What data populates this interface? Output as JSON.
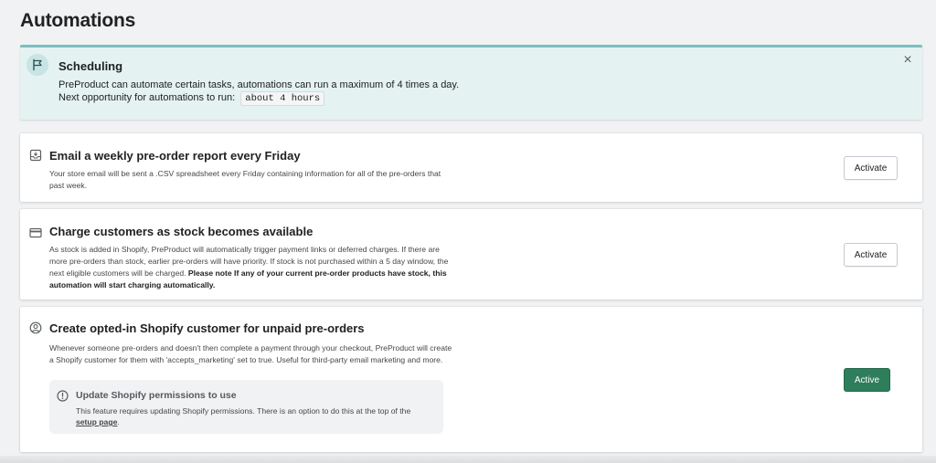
{
  "page": {
    "title": "Automations"
  },
  "banner": {
    "title": "Scheduling",
    "line1": "PreProduct can automate certain tasks, automations can run a maximum of 4 times a day.",
    "line2_prefix": "Next opportunity for automations to run:",
    "next_run": "about 4 hours",
    "close_symbol": "×"
  },
  "cards": [
    {
      "title": "Email a weekly pre-order report every Friday",
      "description": "Your store email will be sent a .CSV spreadsheet every Friday containing information for all of the pre-orders that past week.",
      "button_label": "Activate",
      "icon": "inbox-download-icon"
    },
    {
      "title": "Charge customers as stock becomes available",
      "description": "As stock is added in Shopify, PreProduct will automatically trigger payment links or deferred charges. If there are more pre-orders than stock, earlier pre-orders will have priority. If stock is not purchased within a 5 day window, the next eligible customers will be charged.",
      "description_bold": "Please note If any of your current pre-order products have stock, this automation will start charging automatically.",
      "button_label": "Activate",
      "icon": "credit-card-icon"
    },
    {
      "title": "Create opted-in Shopify customer for unpaid pre-orders",
      "description": "Whenever someone pre-orders and doesn't then complete a payment through your checkout, PreProduct will create a Shopify customer for them with 'accepts_marketing' set to true. Useful for third-party email marketing and more.",
      "button_label": "Active",
      "icon": "customer-icon",
      "notice": {
        "title": "Update Shopify permissions to use",
        "text": "This feature requires updating Shopify permissions. There is an option to do this at the top of the",
        "link": "setup page",
        "suffix": "."
      }
    }
  ],
  "colors": {
    "accent_green": "#2e7d5b",
    "banner_bg": "#e4f2f1",
    "banner_border": "#7dbfbf"
  }
}
